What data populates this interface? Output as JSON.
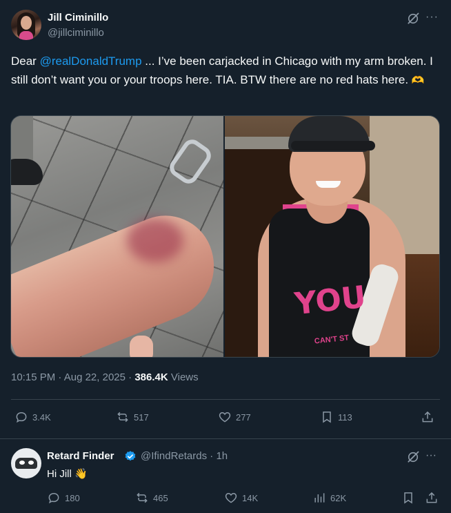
{
  "tweet": {
    "display_name": "Jill Ciminillo",
    "handle": "@jillciminillo",
    "text_prefix": "Dear ",
    "mention": "@realDonaldTrump",
    "text_body": " ... I’ve been carjacked in Chicago with my arm broken. I still don’t want you or your troops here. TIA. BTW there are no red hats here. ",
    "text_emoji": "🫶",
    "media": {
      "left_photo": "photo-of-bruised-forearm",
      "right_photo": "selfie-with-arm-cast",
      "tank_text": "YOU",
      "tank_subtext": "CAN'T ST"
    },
    "time": "10:15 PM",
    "date": "Aug 22, 2025",
    "views_count": "386.4K",
    "views_label": "Views",
    "separator": "·",
    "stats": {
      "replies": "3.4K",
      "reposts": "517",
      "likes": "277",
      "bookmarks": "113"
    }
  },
  "reply": {
    "display_name": "Retard Finder",
    "handle": "@IfindRetards",
    "age": "1h",
    "text": "Hi Jill ",
    "text_emoji": "👋",
    "stats": {
      "replies": "180",
      "reposts": "465",
      "likes": "14K",
      "views": "62K"
    }
  },
  "icons": {
    "more": "···"
  },
  "colors": {
    "background": "#15202b",
    "text": "#f7f9f9",
    "muted": "#8b98a5",
    "accent": "#1d9bf0",
    "divider": "#38444d"
  }
}
